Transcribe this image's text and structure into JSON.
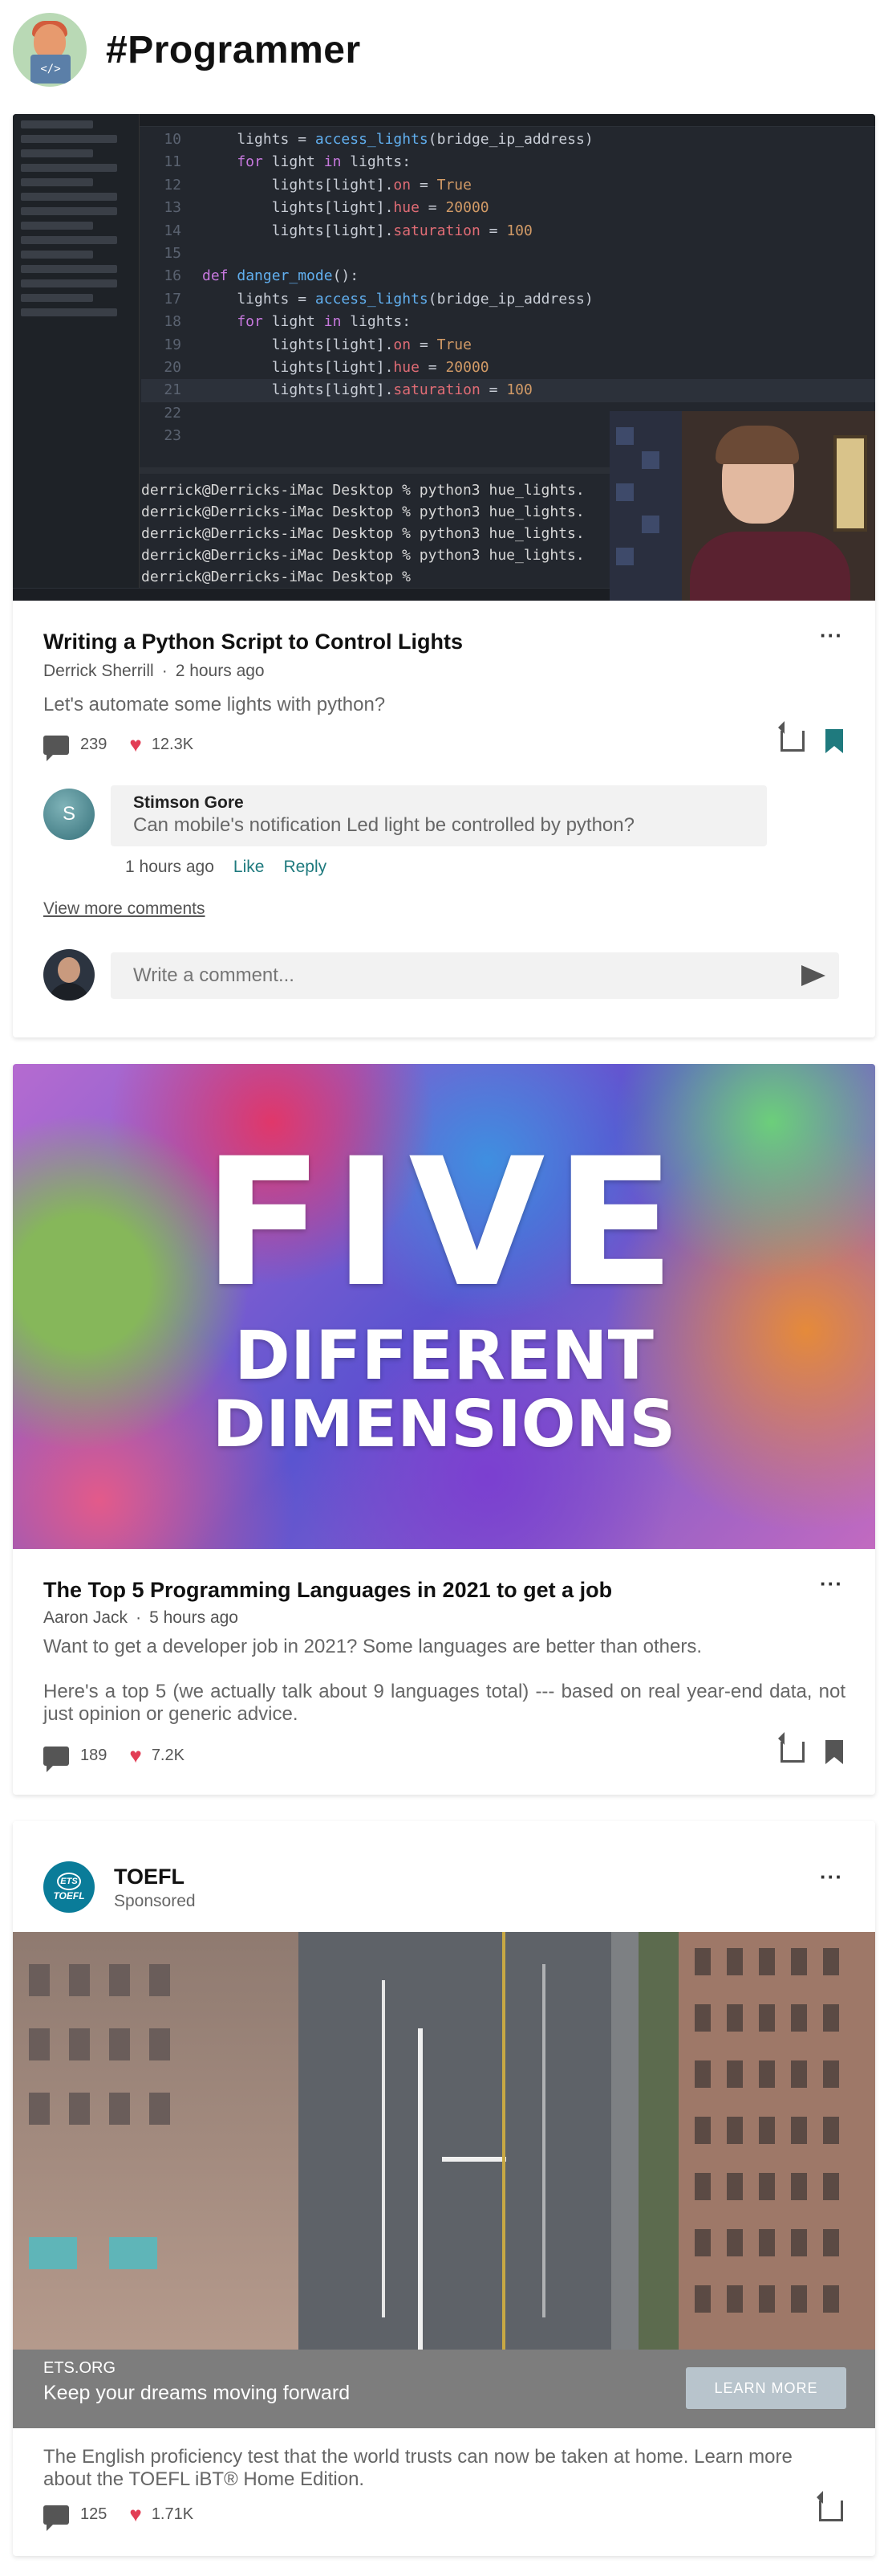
{
  "header": {
    "title": "#Programmer",
    "logo_icon": "programmer-avatar-icon"
  },
  "post1": {
    "code_lines": [
      {
        "n": "10",
        "parts": [
          [
            "tx",
            "    lights = "
          ],
          [
            "fn",
            "access_lights"
          ],
          [
            "tx",
            "(bridge_ip_address)"
          ]
        ]
      },
      {
        "n": "11",
        "parts": [
          [
            "kw",
            "    for "
          ],
          [
            "tx",
            "light "
          ],
          [
            "kw",
            "in "
          ],
          [
            "tx",
            "lights:"
          ]
        ]
      },
      {
        "n": "12",
        "parts": [
          [
            "tx",
            "        lights[light]."
          ],
          [
            "attr",
            "on"
          ],
          [
            "tx",
            " = "
          ],
          [
            "num",
            "True"
          ]
        ]
      },
      {
        "n": "13",
        "parts": [
          [
            "tx",
            "        lights[light]."
          ],
          [
            "attr",
            "hue"
          ],
          [
            "tx",
            " = "
          ],
          [
            "num",
            "20000"
          ]
        ]
      },
      {
        "n": "14",
        "parts": [
          [
            "tx",
            "        lights[light]."
          ],
          [
            "attr",
            "saturation"
          ],
          [
            "tx",
            " = "
          ],
          [
            "num",
            "100"
          ]
        ]
      },
      {
        "n": "15",
        "parts": []
      },
      {
        "n": "16",
        "parts": [
          [
            "kw",
            "def "
          ],
          [
            "fn",
            "danger_mode"
          ],
          [
            "tx",
            "():"
          ]
        ]
      },
      {
        "n": "17",
        "parts": [
          [
            "tx",
            "    lights = "
          ],
          [
            "fn",
            "access_lights"
          ],
          [
            "tx",
            "(bridge_ip_address)"
          ]
        ]
      },
      {
        "n": "18",
        "parts": [
          [
            "kw",
            "    for "
          ],
          [
            "tx",
            "light "
          ],
          [
            "kw",
            "in "
          ],
          [
            "tx",
            "lights:"
          ]
        ]
      },
      {
        "n": "19",
        "parts": [
          [
            "tx",
            "        lights[light]."
          ],
          [
            "attr",
            "on"
          ],
          [
            "tx",
            " = "
          ],
          [
            "num",
            "True"
          ]
        ]
      },
      {
        "n": "20",
        "parts": [
          [
            "tx",
            "        lights[light]."
          ],
          [
            "attr",
            "hue"
          ],
          [
            "tx",
            " = "
          ],
          [
            "num",
            "20000"
          ]
        ]
      },
      {
        "n": "21",
        "parts": [
          [
            "tx",
            "        lights[light]."
          ],
          [
            "attr",
            "saturation"
          ],
          [
            "tx",
            " = "
          ],
          [
            "num",
            "100"
          ]
        ],
        "hl": true
      },
      {
        "n": "22",
        "parts": []
      },
      {
        "n": "23",
        "parts": []
      }
    ],
    "terminal_lines": [
      "derrick@Derricks-iMac Desktop % python3 hue_lights.",
      "derrick@Derricks-iMac Desktop % python3 hue_lights.",
      "derrick@Derricks-iMac Desktop % python3 hue_lights.",
      "derrick@Derricks-iMac Desktop % python3 hue_lights.",
      "derrick@Derricks-iMac Desktop %"
    ],
    "title": "Writing a Python Script to Control Lights",
    "author": "Derrick Sherrill",
    "time": "2 hours ago",
    "description": "Let's automate some lights with python?",
    "comments_count": "239",
    "likes_count": "12.3K",
    "more_label": "···",
    "comment": {
      "avatar_letter": "S",
      "author": "Stimson Gore",
      "text": "Can mobile's notification Led light be controlled by python?",
      "time": "1 hours ago",
      "like_label": "Like",
      "reply_label": "Reply"
    },
    "view_more": "View more comments",
    "comment_placeholder": "Write a comment..."
  },
  "post2": {
    "thumb_big": "FIVE",
    "thumb_mid": "DIFFERENT",
    "thumb_small": "DIMENSIONS",
    "title": "The Top 5 Programming Languages in 2021 to get a job",
    "author": "Aaron Jack",
    "time": "5 hours ago",
    "description_1": "Want to get a developer job in 2021? Some languages are better than others.",
    "description_2": "Here's a top 5 (we actually talk about 9 languages total) --- based on real year-end data, not just opinion or generic advice.",
    "comments_count": "189",
    "likes_count": "7.2K",
    "more_label": "···"
  },
  "ad": {
    "logo_top": "ETS",
    "logo_bottom": "TOEFL",
    "name": "TOEFL",
    "sponsored": "Sponsored",
    "url": "ETS.ORG",
    "tagline": "Keep your dreams moving forward",
    "cta": "LEARN MORE",
    "description": "The English proficiency test that the world trusts can now be taken at home. Learn more about the TOEFL iBT® Home Edition.",
    "comments_count": "125",
    "likes_count": "1.71K",
    "more_label": "···"
  },
  "colors": {
    "accent": "#1f7a7e",
    "heart": "#e23d55",
    "ad_logo": "#0a7c99"
  }
}
